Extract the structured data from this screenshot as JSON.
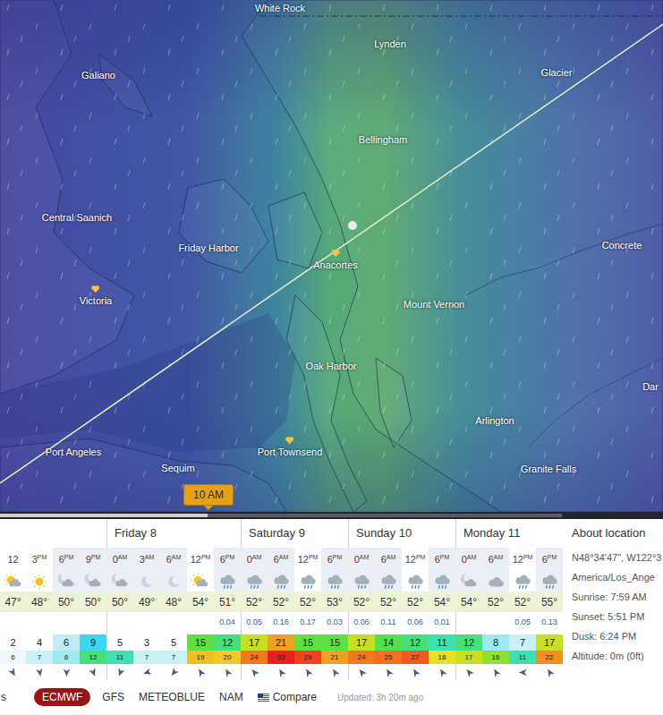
{
  "map": {
    "places": [
      {
        "name": "White Rock",
        "favorite": false
      },
      {
        "name": "Lynden",
        "favorite": false
      },
      {
        "name": "Galiano",
        "favorite": false
      },
      {
        "name": "Glacier",
        "favorite": false
      },
      {
        "name": "Bellingham",
        "favorite": false
      },
      {
        "name": "Central Saanich",
        "favorite": false
      },
      {
        "name": "Friday Harbor",
        "favorite": false
      },
      {
        "name": "Anacortes",
        "favorite": true
      },
      {
        "name": "Concrete",
        "favorite": false
      },
      {
        "name": "Victoria",
        "favorite": true
      },
      {
        "name": "Mount Vernon",
        "favorite": false
      },
      {
        "name": "Oak Harbor",
        "favorite": false
      },
      {
        "name": "Dar",
        "favorite": false
      },
      {
        "name": "Arlington",
        "favorite": false
      },
      {
        "name": "Port Angeles",
        "favorite": false
      },
      {
        "name": "Port Townsend",
        "favorite": true
      },
      {
        "name": "Sequim",
        "favorite": false
      },
      {
        "name": "Granite Falls",
        "favorite": false
      }
    ],
    "timeline": {
      "badge": "10 AM",
      "level": 0.37
    }
  },
  "forecast": {
    "days": [
      {
        "columns": [
          {
            "hour": "12",
            "night": false,
            "icon": "sun-cloud",
            "temp": "47°",
            "wind": "2",
            "wind_color": "#ffffff",
            "gust": "6",
            "gust_color": "#eef8fb",
            "dir": 150
          },
          {
            "hour": "3",
            "suffix": "PM",
            "night": false,
            "icon": "sun",
            "temp": "48°",
            "wind": "4",
            "wind_color": "#ffffff",
            "gust": "7",
            "gust_color": "#c8f2f5",
            "dir": 170
          },
          {
            "hour": "6",
            "suffix": "PM",
            "night": true,
            "icon": "moon-cloud",
            "temp": "50°",
            "wind": "6",
            "wind_color": "#bdeef6",
            "gust": "8",
            "gust_color": "#9eeaf3",
            "dir": 180
          },
          {
            "hour": "9",
            "suffix": "PM",
            "night": true,
            "icon": "moon-cloud",
            "temp": "50°",
            "wind": "9",
            "wind_color": "#3cd6ef",
            "gust": "12",
            "gust_color": "#45e07a",
            "dir": 160
          }
        ]
      },
      {
        "label": "Friday 8",
        "columns": [
          {
            "hour": "0",
            "suffix": "AM",
            "night": true,
            "icon": "moon-cloud",
            "temp": "50°",
            "wind": "5",
            "wind_color": "#ffffff",
            "gust": "11",
            "gust_color": "#3fe0b0",
            "dir": 200
          },
          {
            "hour": "3",
            "suffix": "AM",
            "night": true,
            "icon": "moon",
            "temp": "49°",
            "wind": "3",
            "wind_color": "#ffffff",
            "gust": "7",
            "gust_color": "#c8f2f5",
            "dir": 250
          },
          {
            "hour": "6",
            "suffix": "AM",
            "night": true,
            "icon": "moon",
            "temp": "48°",
            "wind": "5",
            "wind_color": "#ffffff",
            "gust": "7",
            "gust_color": "#c8f2f5",
            "dir": 220
          },
          {
            "hour": "12",
            "suffix": "PM",
            "night": false,
            "icon": "sun-cloud",
            "temp": "54°",
            "wind": "15",
            "wind_color": "#5ee040",
            "gust": "19",
            "gust_color": "#f0c020",
            "dir": 330
          },
          {
            "hour": "6",
            "suffix": "PM",
            "night": true,
            "icon": "cloud-rain",
            "temp": "51°",
            "precip": "0.04",
            "wind": "12",
            "wind_color": "#45e07a",
            "gust": "20",
            "gust_color": "#f0c828",
            "dir": 330
          }
        ]
      },
      {
        "label": "Saturday 9",
        "columns": [
          {
            "hour": "0",
            "suffix": "AM",
            "night": true,
            "icon": "cloud-rain",
            "temp": "52°",
            "precip": "0.05",
            "wind": "17",
            "wind_color": "#c8e020",
            "gust": "24",
            "gust_color": "#f07820",
            "dir": 320
          },
          {
            "hour": "6",
            "suffix": "AM",
            "night": true,
            "icon": "cloud-rain",
            "temp": "52°",
            "precip": "0.16",
            "wind": "21",
            "wind_color": "#f0a020",
            "gust": "33",
            "gust_color": "#e82020",
            "dir": 330
          },
          {
            "hour": "12",
            "suffix": "PM",
            "night": false,
            "icon": "cloud-rain",
            "temp": "52°",
            "precip": "0.17",
            "wind": "15",
            "wind_color": "#5ee040",
            "gust": "29",
            "gust_color": "#f04020",
            "dir": 330
          },
          {
            "hour": "6",
            "suffix": "PM",
            "night": true,
            "icon": "cloud-rain",
            "temp": "53°",
            "precip": "0.03",
            "wind": "15",
            "wind_color": "#5ee040",
            "gust": "21",
            "gust_color": "#f0a020",
            "dir": 330
          }
        ]
      },
      {
        "label": "Sunday 10",
        "columns": [
          {
            "hour": "0",
            "suffix": "AM",
            "night": true,
            "icon": "cloud-rain",
            "temp": "52°",
            "precip": "0.06",
            "wind": "17",
            "wind_color": "#c8e020",
            "gust": "24",
            "gust_color": "#f07820",
            "dir": 320
          },
          {
            "hour": "6",
            "suffix": "AM",
            "night": true,
            "icon": "cloud-rain",
            "temp": "52°",
            "precip": "0.11",
            "wind": "14",
            "wind_color": "#50e050",
            "gust": "25",
            "gust_color": "#f07020",
            "dir": 330
          },
          {
            "hour": "12",
            "suffix": "PM",
            "night": false,
            "icon": "cloud-rain",
            "temp": "52°",
            "precip": "0.06",
            "wind": "12",
            "wind_color": "#45e07a",
            "gust": "27",
            "gust_color": "#f05a20",
            "dir": 330
          },
          {
            "hour": "6",
            "suffix": "PM",
            "night": true,
            "icon": "cloud-rain",
            "temp": "54°",
            "precip": "0.01",
            "wind": "11",
            "wind_color": "#3fe0b0",
            "gust": "18",
            "gust_color": "#e8e020",
            "dir": 330
          }
        ]
      },
      {
        "label": "Monday 11",
        "columns": [
          {
            "hour": "0",
            "suffix": "AM",
            "night": true,
            "icon": "moon-cloud",
            "temp": "54°",
            "wind": "12",
            "wind_color": "#45e07a",
            "gust": "17",
            "gust_color": "#c8e020",
            "dir": 320
          },
          {
            "hour": "6",
            "suffix": "AM",
            "night": true,
            "icon": "cloud",
            "temp": "52°",
            "wind": "8",
            "wind_color": "#9eeaf3",
            "gust": "16",
            "gust_color": "#90e030",
            "dir": 330
          },
          {
            "hour": "12",
            "suffix": "PM",
            "night": false,
            "icon": "cloud-rain",
            "temp": "52°",
            "precip": "0.05",
            "wind": "7",
            "wind_color": "#c8f2f5",
            "gust": "11",
            "gust_color": "#3fe0b0",
            "dir": 270
          },
          {
            "hour": "6",
            "suffix": "PM",
            "night": true,
            "icon": "cloud-rain",
            "temp": "55°",
            "precip": "0.13",
            "wind": "17",
            "wind_color": "#c8e020",
            "gust": "22",
            "gust_color": "#f09020",
            "dir": 330
          }
        ]
      }
    ]
  },
  "about": {
    "title": "About location",
    "lines": [
      "N48°34'47\", W122°3",
      "America/Los_Ange",
      "Sunrise: 7:59 AM",
      "Sunset: 5:51 PM",
      "Dusk: 6:24 PM",
      "Altitude: 0m (0ft)"
    ]
  },
  "models": [
    {
      "label": "s",
      "kind": "label",
      "selected": false
    },
    {
      "label": "ECMWF",
      "kind": "model",
      "selected": true
    },
    {
      "label": "GFS",
      "kind": "model",
      "selected": false
    },
    {
      "label": "METEOBLUE",
      "kind": "model",
      "selected": false
    },
    {
      "label": "NAM",
      "kind": "model",
      "selected": false
    },
    {
      "label": "Compare",
      "kind": "compare",
      "selected": false
    }
  ],
  "updated": "Updated: 3h 20m ago"
}
